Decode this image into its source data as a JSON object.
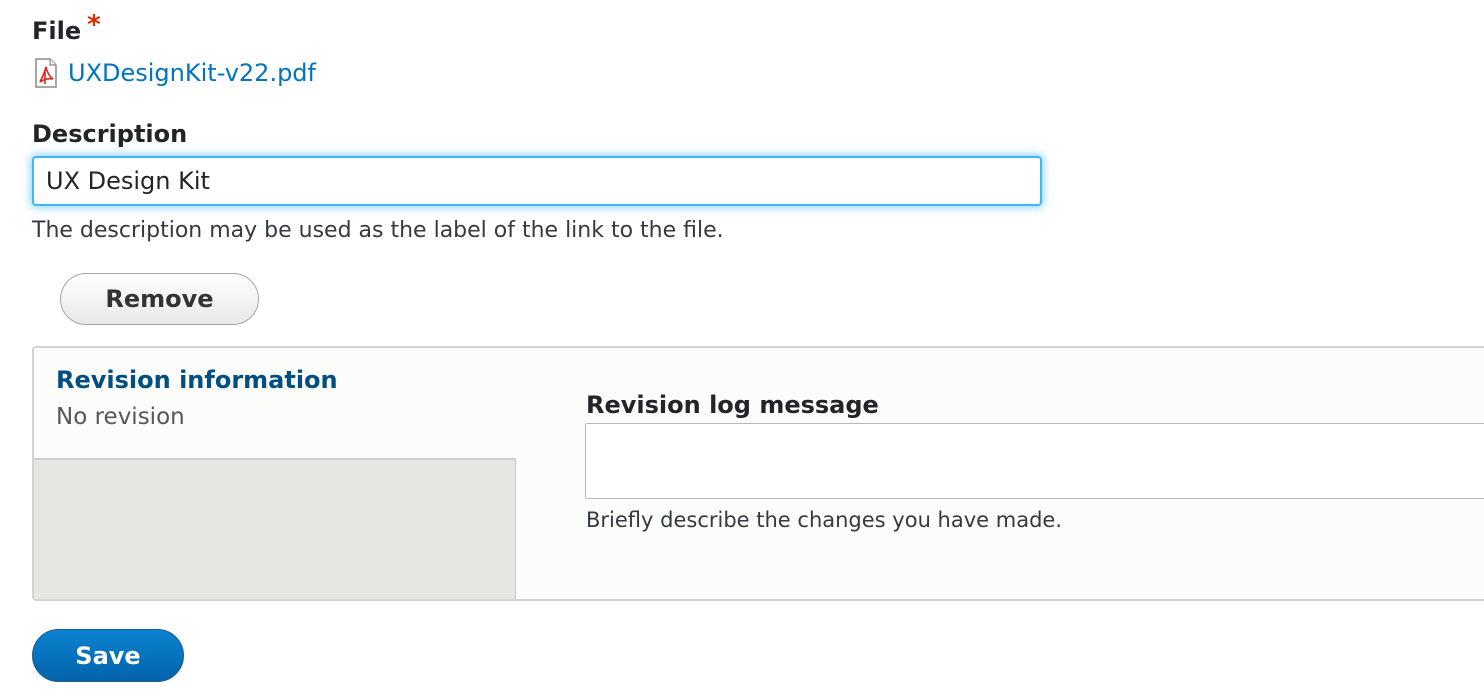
{
  "file_field": {
    "label": "File",
    "required_mark": "*",
    "file_icon": "pdf-file-icon",
    "file_name": "UXDesignKit-v22.pdf"
  },
  "description_field": {
    "label": "Description",
    "value": "UX Design Kit",
    "help_text": "The description may be used as the label of the link to the file."
  },
  "remove_button": {
    "label": "Remove"
  },
  "revision": {
    "tab_title": "Revision information",
    "tab_summary": "No revision",
    "log_label": "Revision log message",
    "log_value": "",
    "log_help": "Briefly describe the changes you have made."
  },
  "save_button": {
    "label": "Save"
  },
  "colors": {
    "link": "#0074bd",
    "required": "#e32700",
    "focus": "#40b6ff",
    "primary_button": "#0263ab",
    "tab_title": "#004f80"
  }
}
